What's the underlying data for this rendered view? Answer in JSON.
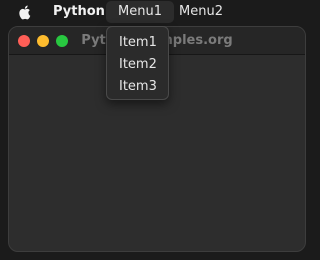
{
  "menubar": {
    "app_name": "Python",
    "menus": [
      {
        "label": "Menu1"
      },
      {
        "label": "Menu2"
      }
    ]
  },
  "window": {
    "title": "PythonExamples.org"
  },
  "dropdown": {
    "items": [
      {
        "label": "Item1"
      },
      {
        "label": "Item2"
      },
      {
        "label": "Item3"
      }
    ]
  },
  "colors": {
    "traffic_red": "#ff5f57",
    "traffic_yellow": "#febc2e",
    "traffic_green": "#28c840"
  }
}
